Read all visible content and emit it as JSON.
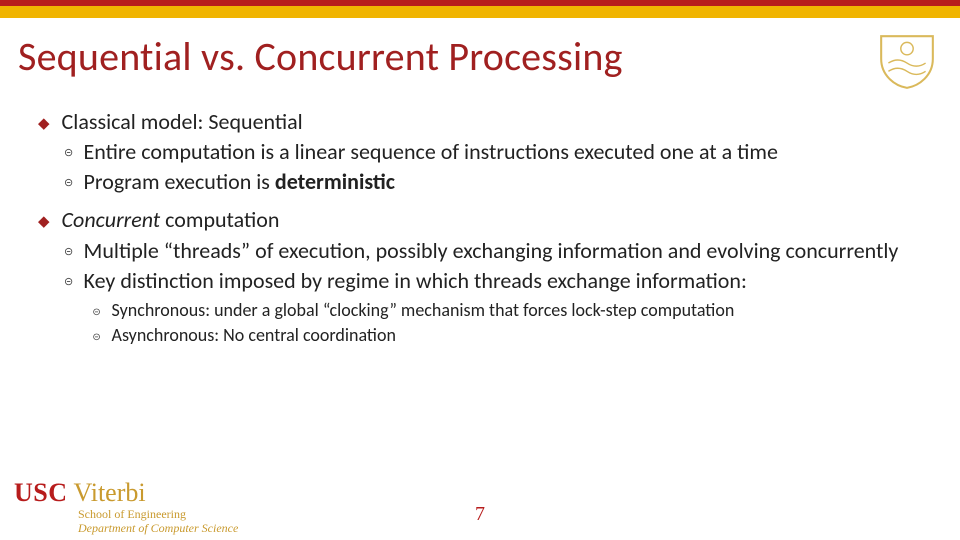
{
  "title": "Sequential vs. Concurrent Processing",
  "bullets": [
    {
      "head": "Classical model: Sequential",
      "subs": [
        {
          "pre": "Entire computation is a linear sequence of instructions executed one at a time"
        },
        {
          "pre": "Program execution is ",
          "bold": "deterministic"
        }
      ]
    },
    {
      "head_ital": "Concurrent",
      "head_rest": " computation",
      "subs": [
        {
          "pre": "Multiple “threads” of execution, possibly exchanging information and evolving concurrently"
        },
        {
          "pre": "Key distinction imposed by regime in which threads exchange information:"
        }
      ],
      "subsubs": [
        {
          "text": "Synchronous: under a global “clocking” mechanism that forces lock-step computation"
        },
        {
          "text": "Asynchronous: No central coordination"
        }
      ]
    }
  ],
  "footer": {
    "usc": "USC",
    "viterbi": "Viterbi",
    "school": "School of Engineering",
    "dept": "Department of Computer Science"
  },
  "page": "7"
}
